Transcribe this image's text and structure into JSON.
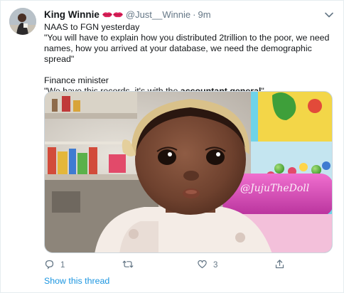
{
  "tweet": {
    "display_name": "King Winnie",
    "handle": "@Just__Winnie",
    "separator": "·",
    "time": "9m",
    "lines": [
      "NAAS to FGN yesterday",
      "\"You will have to explain how you distributed 2trillion to the poor, we need names, how you arrived at your database, we need the demographic spread\"",
      "Finance minister"
    ],
    "quote_start": "\"We have this records, it's with the ",
    "quote_bold": "accountant general",
    "quote_end": "\"",
    "watermark": "@JujuTheDoll"
  },
  "actions": {
    "reply_count": "1",
    "retweet_count": "",
    "like_count": "3"
  },
  "show_thread": "Show this thread",
  "colors": {
    "link": "#1b95e0",
    "muted": "#657786",
    "text": "#14171a",
    "lips": "#e0245e"
  },
  "icons": [
    "avatar",
    "lips-emoji",
    "chevron-down-icon",
    "reply-icon",
    "retweet-icon",
    "like-icon",
    "share-icon"
  ]
}
